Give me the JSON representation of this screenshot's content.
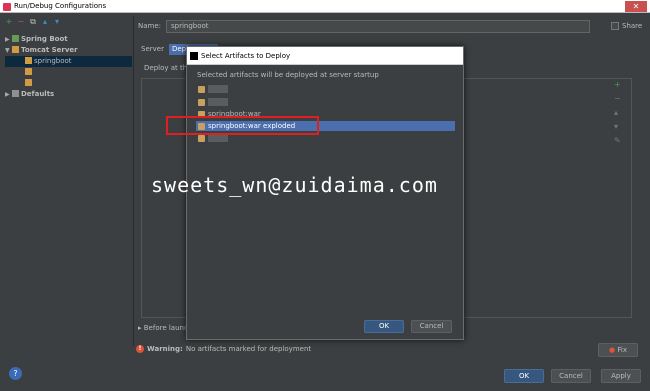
{
  "window": {
    "title": "Run/Debug Configurations",
    "close": "✕"
  },
  "toolbar": {
    "add": "+",
    "remove": "−",
    "copy": "⧉",
    "move": "▴",
    "down": "▾"
  },
  "tree": [
    {
      "label": "Spring Boot",
      "bold": true
    },
    {
      "label": "Tomcat Server",
      "bold": true
    },
    {
      "label": "springboot",
      "selected": true
    },
    {
      "label": ""
    },
    {
      "label": ""
    },
    {
      "label": "Defaults",
      "bold": true
    }
  ],
  "form": {
    "name_label": "Name:",
    "name_value": "springboot",
    "share_label": "Share"
  },
  "tabs": [
    "Server",
    "Deployment"
  ],
  "deploy_label": "Deploy at the",
  "before_launch": "Before launch",
  "warning": {
    "prefix": "Warning:",
    "text": "No artifacts marked for deployment"
  },
  "fix_button": "Fix",
  "help": "?",
  "buttons": {
    "ok": "OK",
    "cancel": "Cancel",
    "apply": "Apply"
  },
  "dialog": {
    "title": "Select Artifacts to Deploy",
    "description": "Selected artifacts will be deployed at server startup",
    "artifacts": [
      "",
      "",
      "springboot:war",
      "springboot:war exploded",
      ""
    ],
    "ok": "OK",
    "cancel": "Cancel"
  },
  "watermark": "sweets_wn@zuidaima.com",
  "colors": {
    "accent": "#4b6eaf",
    "highlight": "#e02020",
    "bg": "#3c3f41"
  }
}
